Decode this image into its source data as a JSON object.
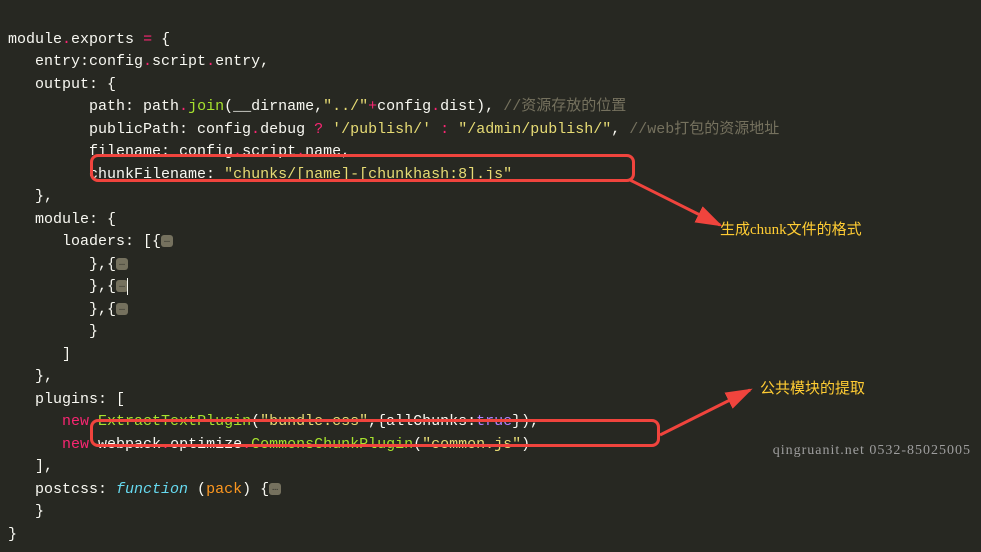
{
  "code": {
    "l1a": "module",
    "l1b": ".",
    "l1c": "exports",
    "l1d": " ",
    "l1e": "=",
    "l1f": " {",
    "l2a": "   entry:config",
    "l2b": ".",
    "l2c": "script",
    "l2d": ".",
    "l2e": "entry,",
    "l3a": "   output",
    "l3b": ": {",
    "l4a": "         path",
    "l4b": ": path",
    "l4c": ".",
    "l4d": "join",
    "l4e": "(__dirname,",
    "l4f": "\"../\"",
    "l4g": "+",
    "l4h": "config",
    "l4i": ".",
    "l4j": "dist), ",
    "l4k": "//资源存放的位置",
    "l5a": "         publicPath",
    "l5b": ": config",
    "l5c": ".",
    "l5d": "debug ",
    "l5e": "?",
    "l5f": " ",
    "l5g": "'/publish/'",
    "l5h": " ",
    "l5i": ":",
    "l5j": " ",
    "l5k": "\"/admin/publish/\"",
    "l5l": ", ",
    "l5m": "//web打包的资源地址",
    "l6a": "         filename",
    "l6b": ": config",
    "l6c": ".",
    "l6d": "script",
    "l6e": ".",
    "l6f": "name,",
    "l7a": "         chunkFilename",
    "l7b": ": ",
    "l7c": "\"chunks/[name]-[chunkhash:8].js\"",
    "l8a": "   },",
    "l9a": "   module",
    "l9b": ": {",
    "l10a": "      loaders",
    "l10b": ": [{",
    "l10c": "…",
    "l11a": "         },{",
    "l11b": "…",
    "l12a": "         },{",
    "l12b": "…",
    "l13a": "         },{",
    "l13b": "…",
    "l14a": "         }",
    "l15a": "      ]",
    "l16a": "   },",
    "l17a": "   plugins",
    "l17b": ": [",
    "l18a": "      ",
    "l18b": "new",
    "l18c": " ",
    "l18d": "ExtractTextPlugin",
    "l18e": "(",
    "l18f": "\"bundle.css\"",
    "l18g": ",{allChunks:",
    "l18h": "true",
    "l18i": "}),",
    "l19a": "      ",
    "l19b": "new",
    "l19c": " webpack",
    "l19d": ".",
    "l19e": "optimize",
    "l19f": ".",
    "l19g": "CommonsChunkPlugin",
    "l19h": "(",
    "l19i": "\"common.js\"",
    "l19j": ")",
    "l20a": "   ],",
    "l21a": "   postcss",
    "l21b": ": ",
    "l21c": "function",
    "l21d": " (",
    "l21e": "pack",
    "l21f": ") {",
    "l21g": "…",
    "l22a": "   }",
    "l23a": "}"
  },
  "annotations": {
    "a1": "生成chunk文件的格式",
    "a2": "公共模块的提取"
  },
  "watermark": "qingruanit.net 0532-85025005"
}
